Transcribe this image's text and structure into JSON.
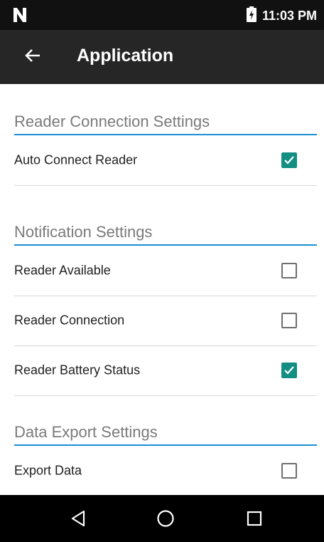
{
  "status_bar": {
    "time": "11:03 PM",
    "left_icon": "n-notification-icon",
    "battery_icon": "battery-charging-icon"
  },
  "toolbar": {
    "title": "Application",
    "back_icon": "arrow-left-icon"
  },
  "sections": [
    {
      "title": "Reader Connection Settings",
      "items": [
        {
          "label": "Auto Connect Reader",
          "checked": true
        }
      ]
    },
    {
      "title": "Notification Settings",
      "items": [
        {
          "label": "Reader Available",
          "checked": false
        },
        {
          "label": "Reader Connection",
          "checked": false
        },
        {
          "label": "Reader Battery Status",
          "checked": true
        }
      ]
    },
    {
      "title": "Data Export Settings",
      "items": [
        {
          "label": "Export Data",
          "checked": false
        }
      ]
    }
  ],
  "nav_bar": {
    "back_icon": "triangle-back-icon",
    "home_icon": "circle-home-icon",
    "recents_icon": "square-recents-icon"
  },
  "colors": {
    "accent": "#1b8fd4",
    "checkbox_checked": "#138e83",
    "toolbar": "#262626",
    "status_bar": "#111111"
  }
}
